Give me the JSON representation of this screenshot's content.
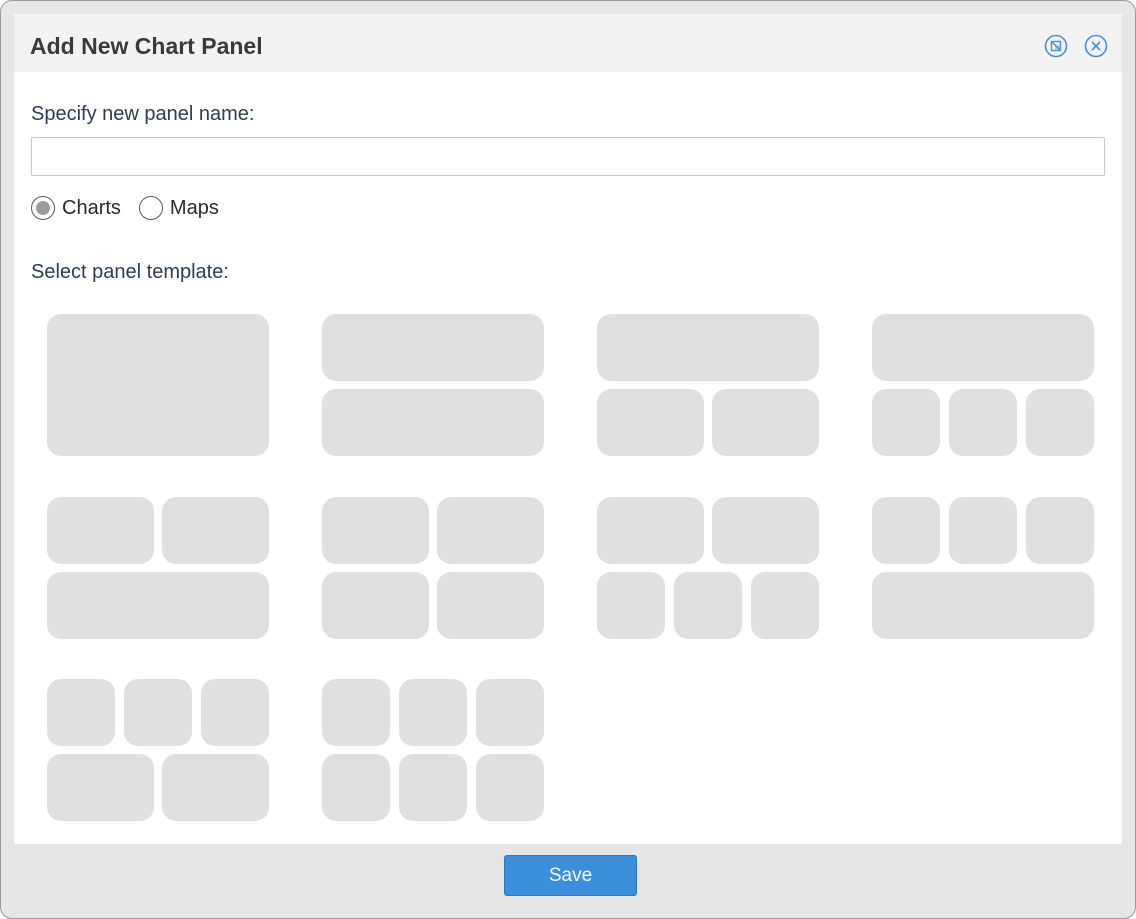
{
  "dialog": {
    "title": "Add New Chart Panel",
    "header_buttons": [
      {
        "icon": "dock-icon",
        "color": "#4a90d9"
      },
      {
        "icon": "close-icon",
        "color": "#4a90d9"
      }
    ]
  },
  "form": {
    "name_label": "Specify new panel name:",
    "name_value": "",
    "name_placeholder": "",
    "type_options": [
      {
        "label": "Charts",
        "selected": true
      },
      {
        "label": "Maps",
        "selected": false
      }
    ],
    "template_label": "Select panel template:"
  },
  "templates": [
    {
      "id": "one-full"
    },
    {
      "id": "two-rows"
    },
    {
      "id": "one-top-two-bottom"
    },
    {
      "id": "one-top-three-bottom"
    },
    {
      "id": "two-top-one-bottom"
    },
    {
      "id": "two-by-two"
    },
    {
      "id": "two-top-three-bottom"
    },
    {
      "id": "three-top-one-bottom"
    },
    {
      "id": "three-top-two-bottom"
    },
    {
      "id": "three-by-two"
    }
  ],
  "footer": {
    "save_label": "Save"
  },
  "colors": {
    "accent": "#3b8fdb",
    "template_block": "#e0e0e0",
    "frame": "#e6e6e6"
  }
}
